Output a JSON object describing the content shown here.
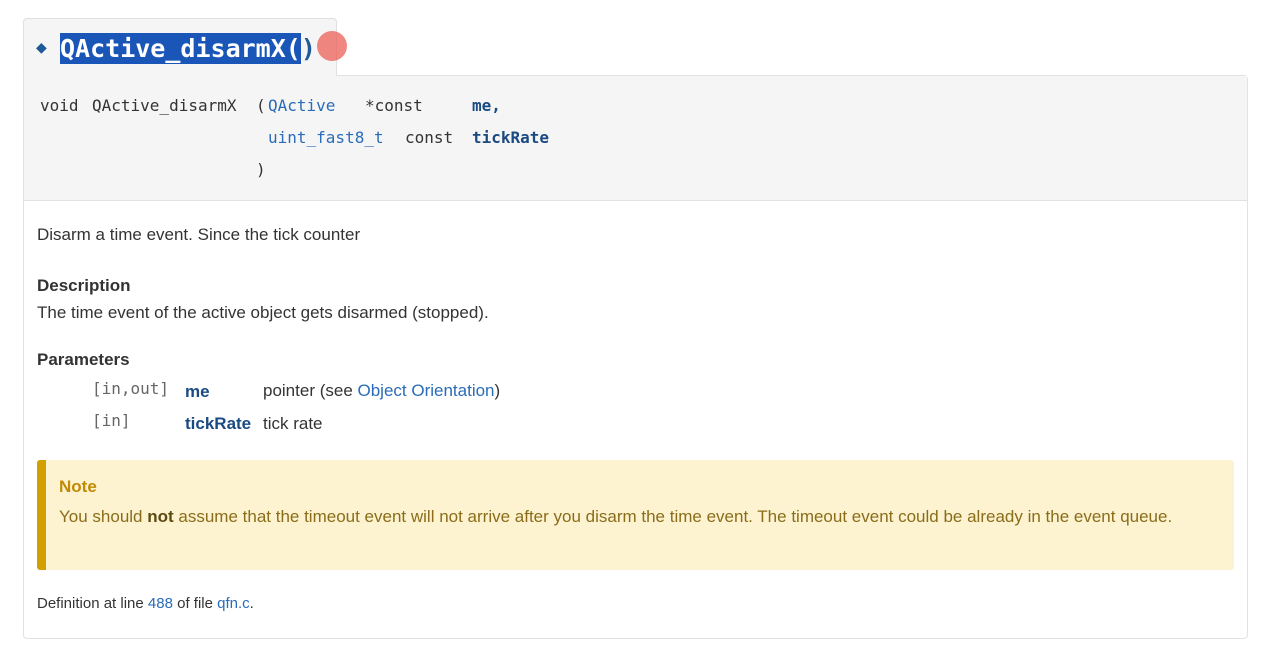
{
  "title": {
    "name": "QActive_disarmX",
    "parens_open": "(",
    "parens_close": ")"
  },
  "prototype": {
    "return_type": "void",
    "function_name": "QActive_disarmX",
    "open_paren": "(",
    "close_paren": ")",
    "params": [
      {
        "type": "QActive",
        "qualifier": "*const",
        "name": "me,"
      },
      {
        "type": "uint_fast8_t",
        "qualifier": "const",
        "name": "tickRate"
      }
    ]
  },
  "brief": "Disarm a time event. Since the tick counter",
  "description": {
    "heading": "Description",
    "text": "The time event of the active object gets disarmed (stopped)."
  },
  "parameters": {
    "heading": "Parameters",
    "items": [
      {
        "dir": "[in,out]",
        "name": "me",
        "desc_prefix": "pointer (see ",
        "link": "Object Orientation",
        "desc_suffix": ")"
      },
      {
        "dir": "[in]",
        "name": "tickRate",
        "desc": "tick rate"
      }
    ]
  },
  "note": {
    "title": "Note",
    "text_before": "You should ",
    "emphasis": "not",
    "text_after": " assume that the timeout event will not arrive after you disarm the time event. The timeout event could be already in the event queue."
  },
  "definition": {
    "prefix": "Definition at line ",
    "line": "488",
    "middle": " of file ",
    "file": "qfn.c",
    "suffix": "."
  },
  "colors": {
    "title": "#1e5a96",
    "selection": "#1a56b8",
    "link": "#2a6cb8",
    "note_bg": "#fdf3d0",
    "note_border": "#d39e00"
  }
}
